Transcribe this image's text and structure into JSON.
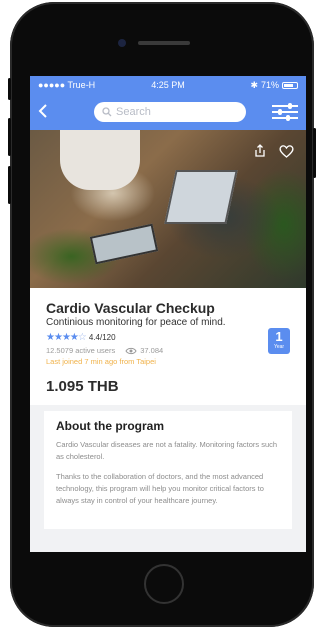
{
  "status": {
    "carrier": "●●●●● True-H",
    "time": "4:25 PM",
    "battery": "71%"
  },
  "nav": {
    "search_placeholder": "Search"
  },
  "program": {
    "title": "Cardio Vascular Checkup",
    "subtitle": "Continious monitoring for peace of mind.",
    "rating": 4.4,
    "rating_text": "4.4/120",
    "active_users": "12.5079 active users",
    "views": "37.084",
    "last_joined": "Last joined 7 min ago from Taipei",
    "duration_number": "1",
    "duration_unit": "Year",
    "price": "1.095 THB"
  },
  "about": {
    "heading": "About the program",
    "paragraph1": "Cardio Vascular diseases are not a fatality. Monitoring factors such as cholesterol.",
    "paragraph2": "Thanks to the collaboration of doctors, and the most advanced technology, this program will help you monitor critical factors to always stay in control of your healthcare journey."
  },
  "colors": {
    "accent": "#5b8def",
    "highlight": "#f0b24a"
  },
  "icons": [
    "back-icon",
    "search-icon",
    "filter-icon",
    "share-icon",
    "heart-icon",
    "eye-icon",
    "star-icon",
    "wifi-icon",
    "bluetooth-icon",
    "battery-icon"
  ]
}
